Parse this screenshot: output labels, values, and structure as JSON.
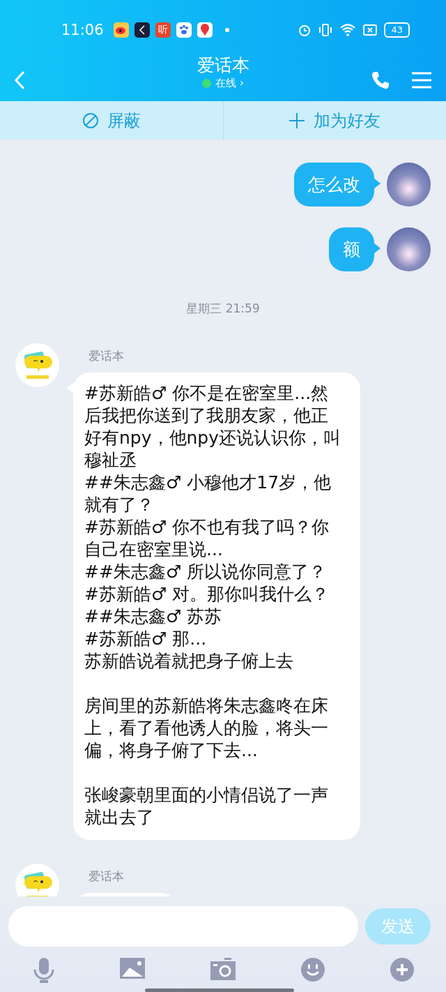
{
  "status_bar": {
    "time": "11:06",
    "notifications": [
      {
        "kind": "weibo"
      },
      {
        "kind": "dark"
      },
      {
        "kind": "ting",
        "label": "听"
      },
      {
        "kind": "paw"
      },
      {
        "kind": "pin"
      }
    ],
    "battery": "43"
  },
  "header": {
    "title": "爱话本",
    "status": "在线",
    "status_chevron": "›"
  },
  "actions": [
    {
      "kind": "block",
      "label": "屏蔽"
    },
    {
      "kind": "add",
      "label": "加为好友"
    }
  ],
  "messages": [
    {
      "kind": "own",
      "text": "怎么改"
    },
    {
      "kind": "own",
      "text": "额"
    },
    {
      "kind": "time",
      "text": "星期三 21:59"
    },
    {
      "kind": "other",
      "sender": "爱话本",
      "paragraphs": [
        {
          "lines": [
            "#苏新皓♂ 你不是在密室里...然后我把你送到了我朋友家，他正好有npy，他npy还说认识你，叫穆祉丞",
            "##朱志鑫♂ 小穆他才17岁，他就有了？",
            "#苏新皓♂ 你不也有我了吗？你自己在密室里说...",
            "##朱志鑫♂ 所以说你同意了？",
            "#苏新皓♂ 对。那你叫我什么？",
            "##朱志鑫♂ 苏苏",
            "#苏新皓♂ 那...",
            "苏新皓说着就把身子俯上去"
          ]
        },
        {
          "lines": [
            "房间里的苏新皓将朱志鑫咚在床上，看了看他诱人的脸，将头一偏，将身子俯了下去..."
          ]
        },
        {
          "lines": [
            "张峻豪朝里面的小情侣说了一声就出去了"
          ]
        }
      ]
    },
    {
      "kind": "other",
      "sender": "爱话本"
    }
  ],
  "composer": {
    "send": "发送",
    "send_disabled": true
  },
  "toolbar": [
    {
      "kind": "mic"
    },
    {
      "kind": "image"
    },
    {
      "kind": "camera"
    },
    {
      "kind": "emoji"
    },
    {
      "kind": "plus"
    }
  ]
}
